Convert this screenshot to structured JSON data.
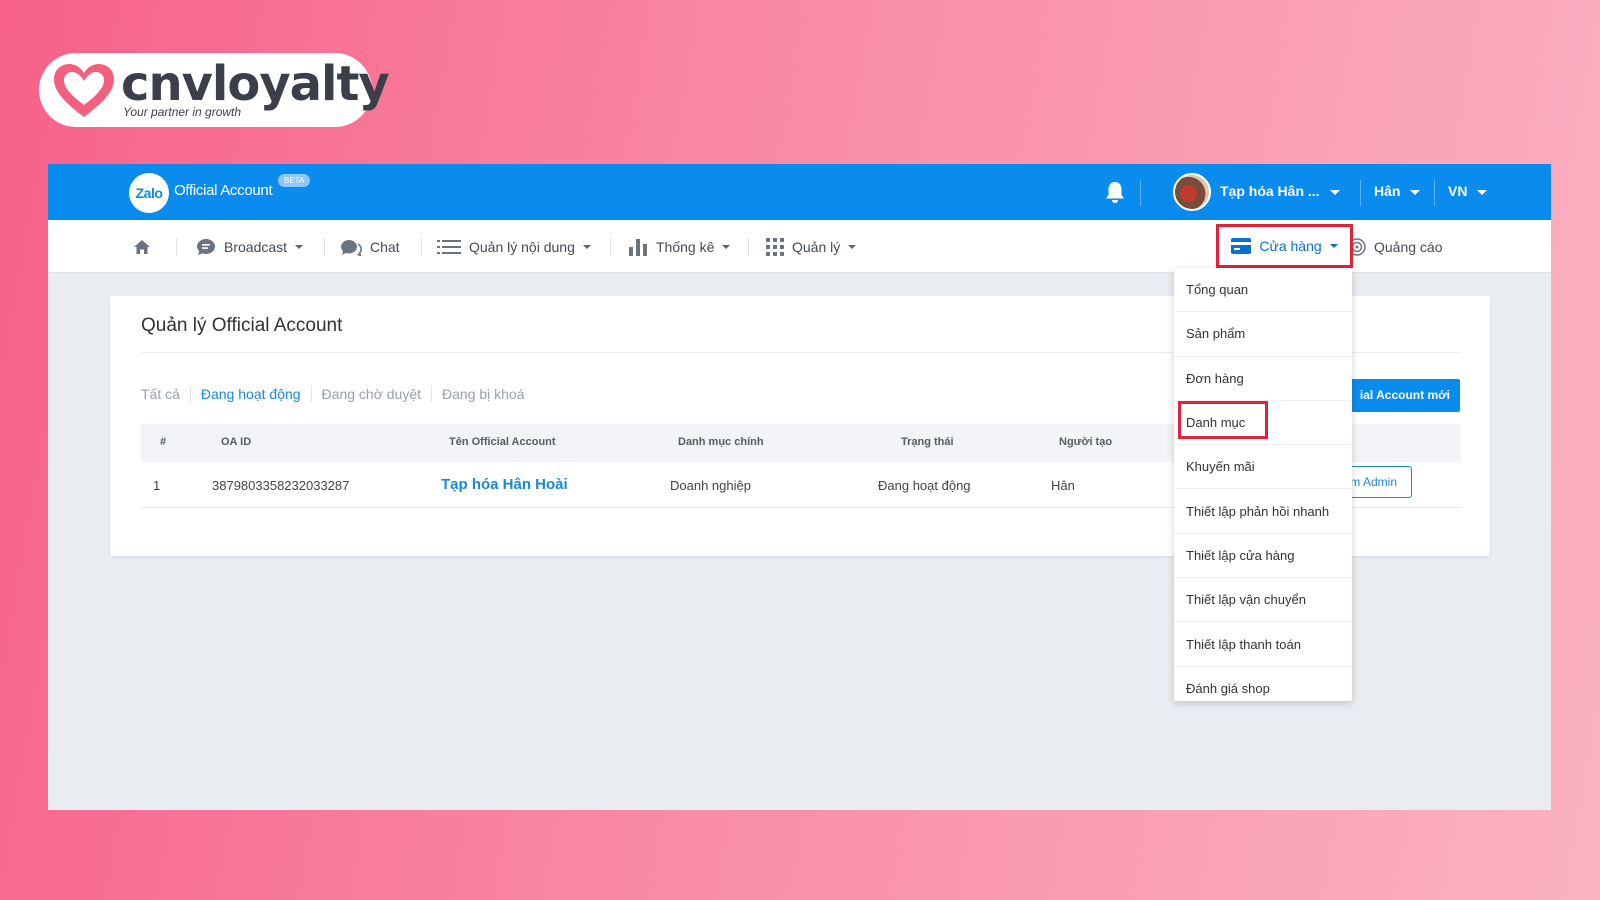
{
  "brand": {
    "name": "cnvloyalty",
    "tagline": "Your partner in growth",
    "colors": {
      "heart": "#f2607f",
      "text": "#3a3f4a"
    }
  },
  "topbar": {
    "logo_text": "Zalo",
    "title": "Official Account",
    "beta_badge": "BETA",
    "bell_icon": "bell-icon",
    "account_name": "Tạp hóa Hân ...",
    "user_name": "Hân",
    "language": "VN",
    "color": "#0a8bee"
  },
  "navbar": {
    "home_icon": "home-icon",
    "items": [
      {
        "label": "Broadcast",
        "icon": "chat-bubble-icon",
        "has_caret": true
      },
      {
        "label": "Chat",
        "icon": "chat-icon",
        "has_caret": false
      },
      {
        "label": "Quản lý nội dung",
        "icon": "list-icon",
        "has_caret": true
      },
      {
        "label": "Thống kê",
        "icon": "bar-chart-icon",
        "has_caret": true
      },
      {
        "label": "Quản lý",
        "icon": "grid-icon",
        "has_caret": true
      }
    ],
    "store": {
      "label": "Cửa hàng",
      "icon": "store-card-icon",
      "highlight_color": "#e0223a"
    },
    "ads": {
      "label": "Quảng cáo",
      "icon": "target-icon"
    }
  },
  "card": {
    "title": "Quản lý Official Account",
    "filters": [
      {
        "label": "Tất cả",
        "active": false
      },
      {
        "label": "Đang hoạt động",
        "active": true
      },
      {
        "label": "Đang chờ duyệt",
        "active": false
      },
      {
        "label": "Đang bị khoá",
        "active": false
      }
    ],
    "create_button": "ial Account mới",
    "table": {
      "headers": [
        "#",
        "OA ID",
        "Tên Official Account",
        "Danh mục chính",
        "Trạng thái",
        "Người tạo"
      ],
      "rows": [
        {
          "index": "1",
          "oa_id": "3879803358232033287",
          "name": "Tạp hóa Hân Hoài",
          "category": "Doanh nghiệp",
          "status": "Đang hoạt động",
          "creator": "Hân",
          "action": "i làm Admin"
        }
      ]
    }
  },
  "dropdown": {
    "items": [
      "Tổng quan",
      "Sản phẩm",
      "Đơn hàng",
      "Danh mục",
      "Khuyến mãi",
      "Thiết lập phản hồi nhanh",
      "Thiết lập cửa hàng",
      "Thiết lập vận chuyển",
      "Thiết lập thanh toán",
      "Đánh giá shop"
    ],
    "highlighted_index": 3
  }
}
